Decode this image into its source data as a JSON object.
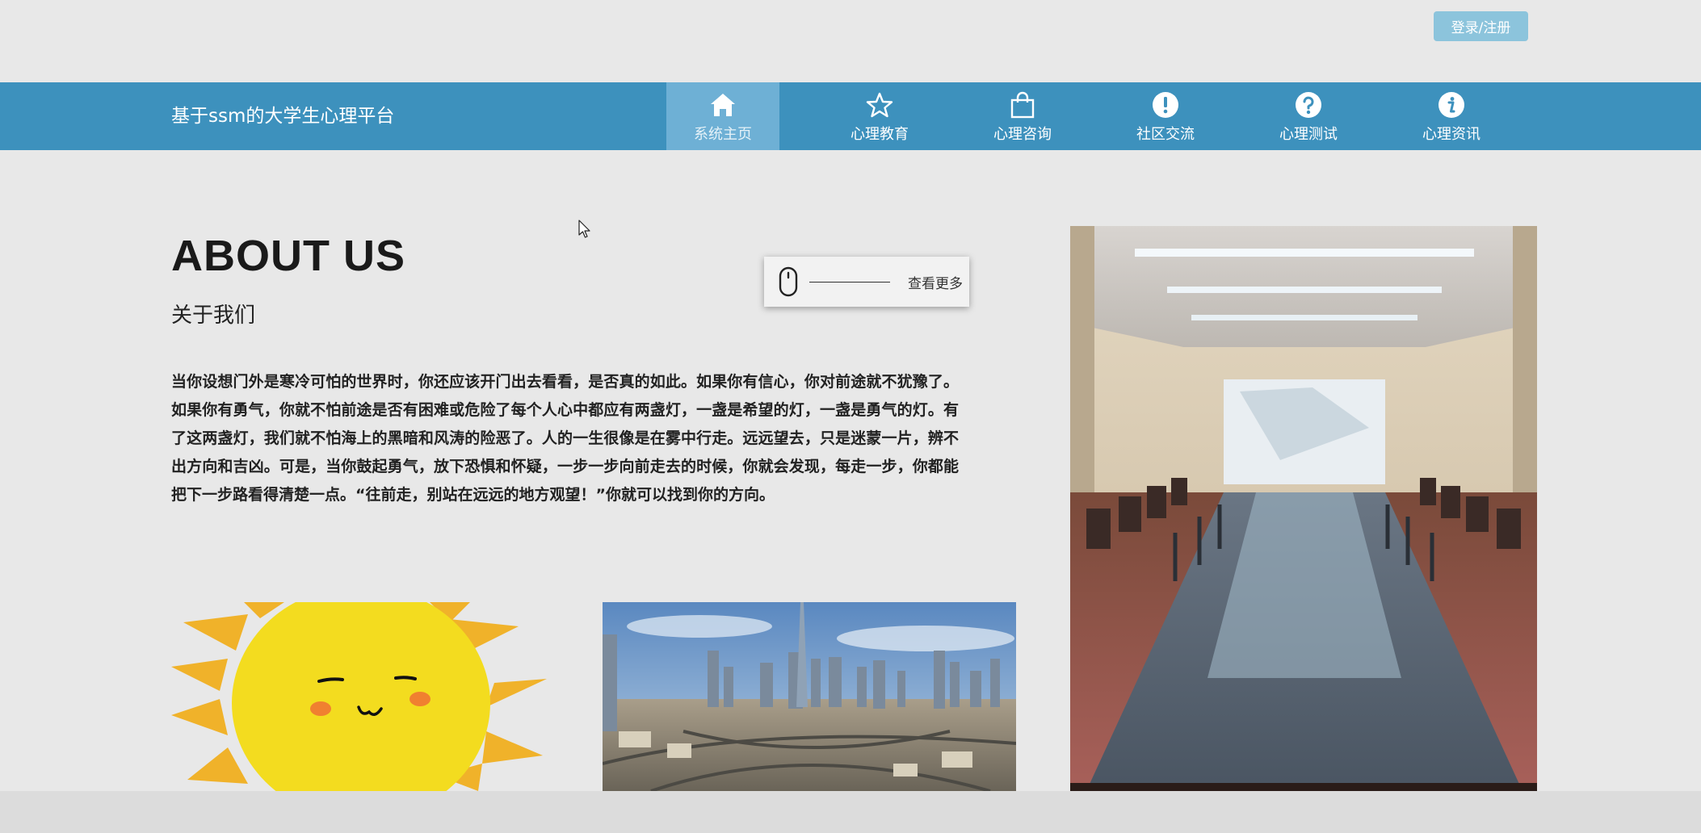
{
  "header": {
    "login_label": "登录/注册"
  },
  "nav": {
    "brand": "基于ssm的大学生心理平台",
    "items": [
      {
        "label": "系统主页",
        "icon": "home-icon",
        "active": true
      },
      {
        "label": "心理教育",
        "icon": "star-icon"
      },
      {
        "label": "心理咨询",
        "icon": "shopping-bag-icon"
      },
      {
        "label": "社区交流",
        "icon": "exclamation-icon"
      },
      {
        "label": "心理测试",
        "icon": "question-icon"
      },
      {
        "label": "心理资讯",
        "icon": "info-icon"
      }
    ]
  },
  "about": {
    "title": "ABOUT US",
    "subtitle": "关于我们",
    "more_label": "查看更多",
    "paragraph": "当你设想门外是寒冷可怕的世界时，你还应该开门出去看看，是否真的如此。如果你有信心，你对前途就不犹豫了。如果你有勇气，你就不怕前途是否有困难或危险了每个人心中都应有两盏灯，一盏是希望的灯，一盏是勇气的灯。有了这两盏灯，我们就不怕海上的黑暗和风涛的险恶了。人的一生很像是在雾中行走。远远望去，只是迷蒙一片，辨不出方向和吉凶。可是，当你鼓起勇气，放下恐惧和怀疑，一步一步向前走去的时候，你就会发现，每走一步，你都能把下一步路看得清楚一点。“往前走，别站在远远的地方观望！”你就可以找到你的方向。"
  },
  "colors": {
    "nav_bg": "#3d91bd",
    "nav_active": "#6eb0d5",
    "login_bg": "#8cc4dc",
    "page_bg": "#e8e8e8"
  }
}
